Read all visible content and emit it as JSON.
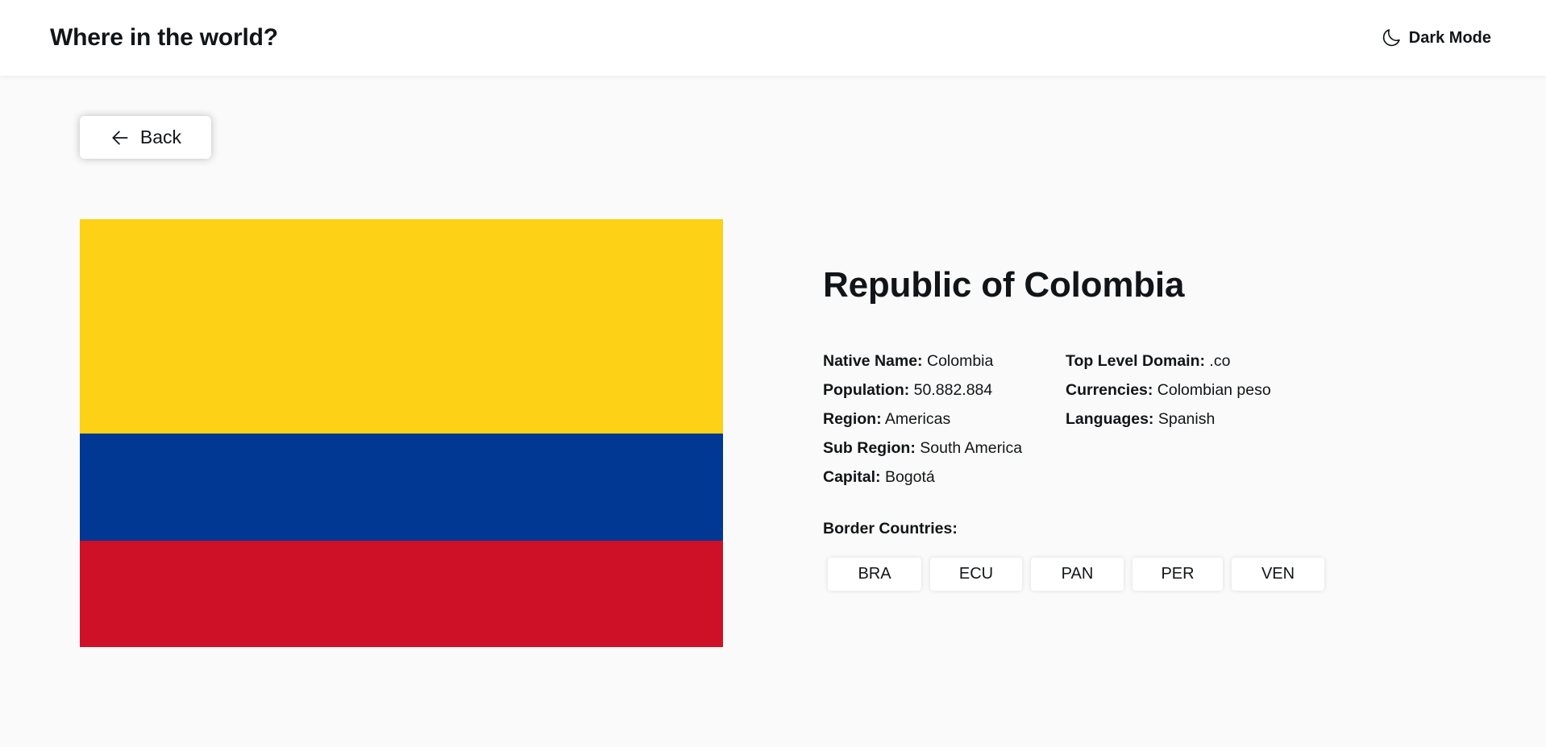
{
  "header": {
    "title": "Where in the world?",
    "theme_toggle_label": "Dark Mode",
    "theme_icon": "moon-icon"
  },
  "back_button": {
    "label": "Back",
    "icon": "arrow-left-icon"
  },
  "country": {
    "name": "Republic of Colombia",
    "flag_colors": [
      "#FCD116",
      "#003893",
      "#CE1126"
    ],
    "info_left": [
      {
        "label": "Native Name:",
        "value": "Colombia"
      },
      {
        "label": "Population:",
        "value": "50.882.884"
      },
      {
        "label": "Region:",
        "value": "Americas"
      },
      {
        "label": "Sub Region:",
        "value": "South America"
      },
      {
        "label": "Capital:",
        "value": "Bogotá"
      }
    ],
    "info_right": [
      {
        "label": "Top Level Domain:",
        "value": ".co"
      },
      {
        "label": "Currencies:",
        "value": "Colombian peso"
      },
      {
        "label": "Languages:",
        "value": "Spanish"
      }
    ],
    "border_label": "Border Countries:",
    "borders": [
      "BRA",
      "ECU",
      "PAN",
      "PER",
      "VEN"
    ]
  },
  "colors": {
    "background": "#fafafa",
    "surface": "#ffffff",
    "text": "#111517"
  }
}
